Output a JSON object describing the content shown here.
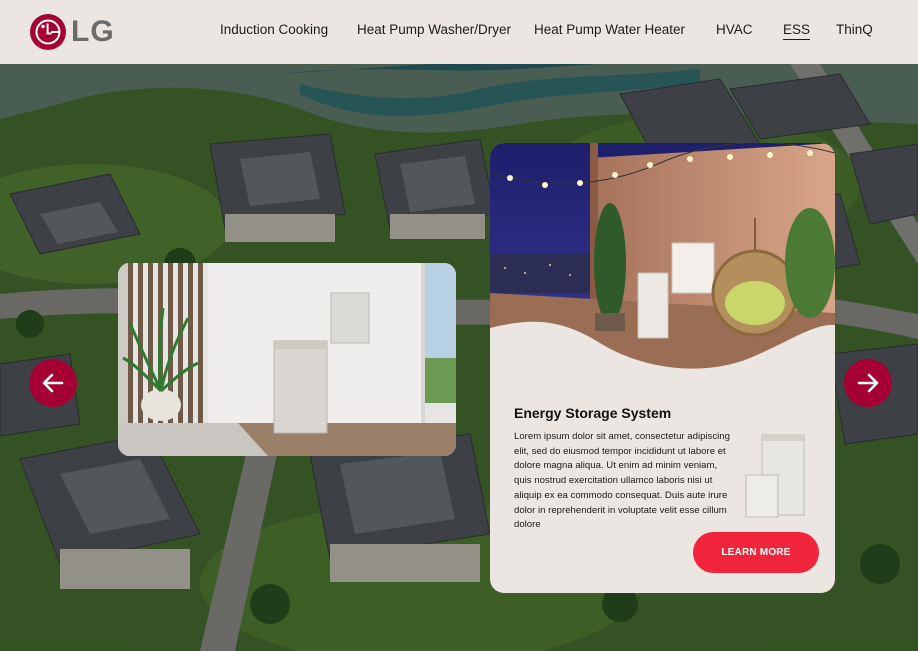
{
  "brand": {
    "name": "LG",
    "accent": "#a50034",
    "cta_color": "#f0253b"
  },
  "nav": {
    "items": [
      {
        "label": "Induction Cooking",
        "active": false
      },
      {
        "label": "Heat Pump Washer/Dryer",
        "active": false
      },
      {
        "label": "Heat Pump Water Heater",
        "active": false
      },
      {
        "label": "HVAC",
        "active": false
      },
      {
        "label": "ESS",
        "active": true
      },
      {
        "label": "ThinQ",
        "active": false
      }
    ]
  },
  "carousel": {
    "prev_icon": "arrow-left-icon",
    "next_icon": "arrow-right-icon"
  },
  "feature_card": {
    "title": "Energy Storage System",
    "body": "Lorem ipsum dolor sit amet, consectetur adipiscing elit, sed do eiusmod tempor incididunt ut labore et dolore magna aliqua. Ut enim ad minim veniam, quis nostrud exercitation ullamco laboris nisi ut aliquip ex ea commodo consequat. Duis aute irure dolor in reprehenderit in voluptate velit esse cillum dolore",
    "cta_label": "LEARN MORE"
  }
}
